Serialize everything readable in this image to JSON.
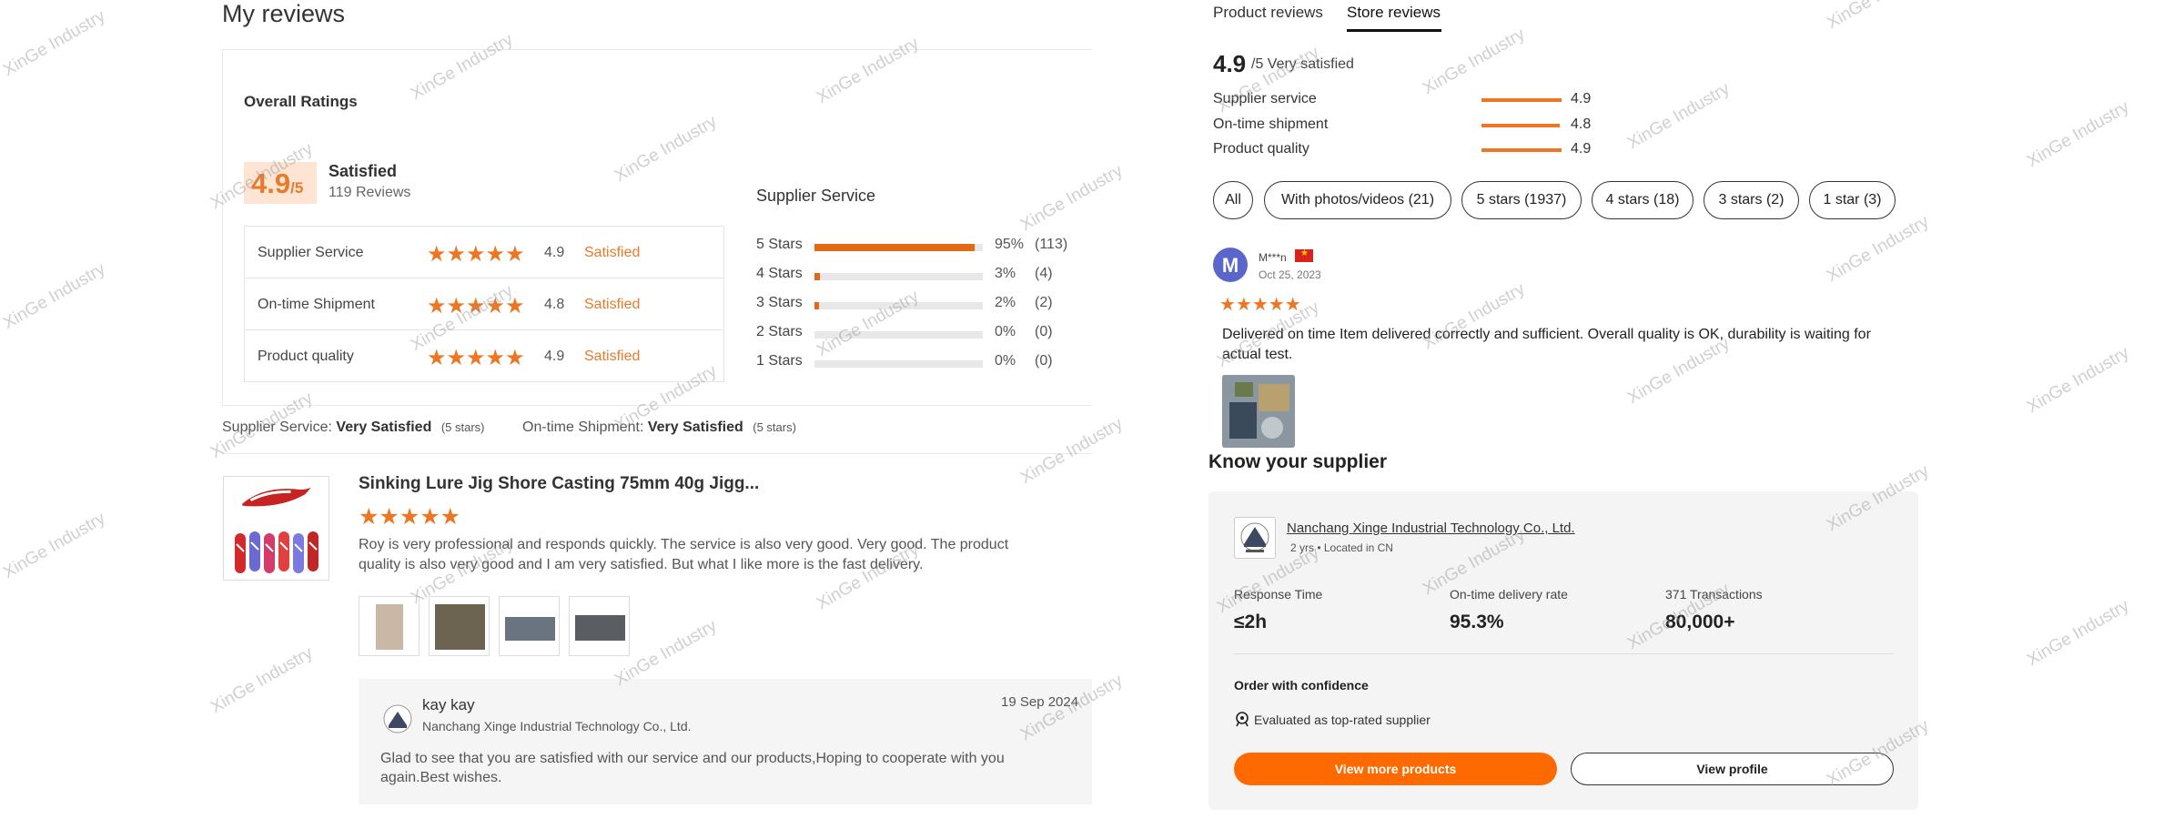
{
  "left": {
    "page_title": "My reviews",
    "overall": {
      "title": "Overall Ratings",
      "score": "4.9",
      "score_suffix": "/5",
      "score_word": "Satisfied",
      "reviews_count": "119 Reviews",
      "rows": [
        {
          "label": "Supplier Service",
          "stars": "★★★★★",
          "value": "4.9",
          "word": "Satisfied"
        },
        {
          "label": "On-time Shipment",
          "stars": "★★★★★",
          "value": "4.8",
          "word": "Satisfied"
        },
        {
          "label": "Product quality",
          "stars": "★★★★★",
          "value": "4.9",
          "word": "Satisfied"
        }
      ]
    },
    "supplier_service": {
      "title": "Supplier Service",
      "distribution": [
        {
          "label": "5  Stars",
          "fraction": 0.95,
          "pct": "95%",
          "count": "(113)"
        },
        {
          "label": "4  Stars",
          "fraction": 0.03,
          "pct": "3%",
          "count": "(4)"
        },
        {
          "label": "3  Stars",
          "fraction": 0.02,
          "pct": "2%",
          "count": "(2)"
        },
        {
          "label": "2  Stars",
          "fraction": 0.0,
          "pct": "0%",
          "count": "(0)"
        },
        {
          "label": "1  Stars",
          "fraction": 0.0,
          "pct": "0%",
          "count": "(0)"
        }
      ]
    },
    "summary": {
      "ss_label": "Supplier Service:",
      "ss_value": "Very Satisfied",
      "ss_stars": "(5 stars)",
      "ot_label": "On-time Shipment:",
      "ot_value": "Very Satisfied",
      "ot_stars": "(5 stars)"
    },
    "review": {
      "product_title": "Sinking Lure Jig Shore Casting 75mm 40g Jigg...",
      "stars": "★★★★★",
      "text": "Roy is very professional and responds quickly. The service is also very good. Very good. The product quality is also very good and I am very satisfied. But what I like more is the fast delivery.",
      "reply": {
        "name": "kay kay",
        "company": "Nanchang Xinge Industrial Technology Co., Ltd.",
        "date": "19 Sep 2024",
        "text": "Glad to see that you are satisfied with our service and our products,Hoping to cooperate with you again.Best wishes."
      }
    }
  },
  "right": {
    "tabs": [
      {
        "label": "Product reviews"
      },
      {
        "label": "Store reviews"
      }
    ],
    "score": "4.9",
    "score_sub": "/5 Very satisfied",
    "metrics": [
      {
        "label": "Supplier service",
        "value": "4.9"
      },
      {
        "label": "On-time shipment",
        "value": "4.8"
      },
      {
        "label": "Product quality",
        "value": "4.9"
      }
    ],
    "filters": [
      {
        "label": "All"
      },
      {
        "label": "With photos/videos (21)"
      },
      {
        "label": "5 stars (1937)"
      },
      {
        "label": "4 stars (18)"
      },
      {
        "label": "3 stars (2)"
      },
      {
        "label": "1 star (3)"
      }
    ],
    "review": {
      "avatar_letter": "M",
      "name": "M***n",
      "date": "Oct 25, 2023",
      "stars": "★★★★★",
      "text": "Delivered on time Item delivered correctly and sufficient. Overall quality is OK, durability is waiting for actual test."
    },
    "know_supplier": {
      "title": "Know your supplier",
      "name": "Nanchang Xinge Industrial Technology Co., Ltd.",
      "meta": "2 yrs • Located in CN",
      "stats": [
        {
          "label": "Response Time",
          "value": "≤2h"
        },
        {
          "label": "On-time delivery rate",
          "value": "95.3%"
        },
        {
          "label": "371 Transactions",
          "value": "80,000+"
        }
      ],
      "confidence_title": "Order with confidence",
      "confidence_text": "Evaluated as top-rated supplier",
      "btn_more": "View more products",
      "btn_profile": "View profile"
    }
  },
  "watermark": "XinGe Industry",
  "colors": {
    "accent": "#ee7623",
    "button": "#ff6a00",
    "avatar": "#5a66c9"
  }
}
